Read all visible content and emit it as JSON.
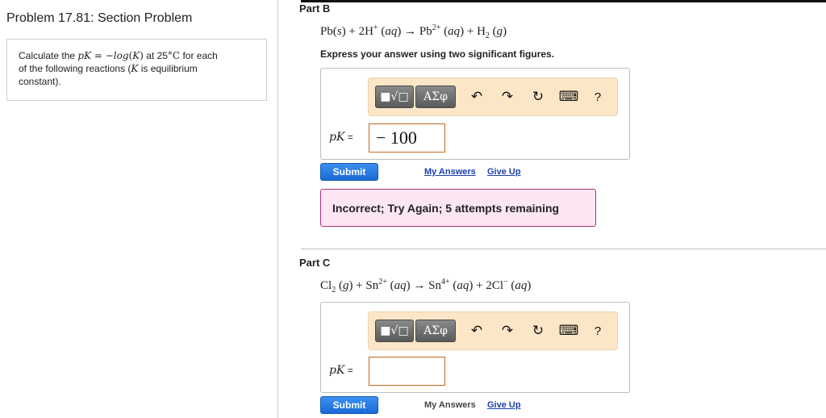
{
  "problem": {
    "title": "Problem 17.81: Section Problem",
    "intro": {
      "calculate": "Calculate the ",
      "pk": "pK",
      "eq_minus_log": " = −",
      "log": "log",
      "open_paren": "(",
      "k": "K",
      "close_paren": ")",
      "at": " at 25",
      "deg_c": "°C",
      "for_each": " for each",
      "line2_a": "of the following reactions (",
      "line2_k": "K",
      "line2_b": " is equilibrium",
      "line3": "constant)."
    }
  },
  "toolbar": {
    "template_symbol": "■√□",
    "greek_label": "ΑΣφ",
    "undo_icon": "↶",
    "redo_icon": "↷",
    "reset_icon": "↻",
    "keyboard_icon": "⌨",
    "help_label": "?"
  },
  "part_b": {
    "label": "Part B",
    "equation": {
      "t1": "Pb(",
      "t1i": "s",
      "t2": ") + 2H",
      "t2s": "+",
      "t3": " (",
      "t3i": "aq",
      "t4": ") → Pb",
      "t4s": "2+",
      "t5": " (",
      "t5i": "aq",
      "t6": ") + H",
      "t6sub": "2",
      "t7": " (",
      "t7i": "g",
      "t8": ")"
    },
    "instruction": "Express your answer using two significant figures.",
    "pk_label": "pK",
    "eq_sign": " =",
    "answer_value": "− 100",
    "submit_label": "Submit",
    "my_answers": "My Answers",
    "give_up": "Give Up",
    "feedback": "Incorrect; Try Again; 5 attempts remaining"
  },
  "part_c": {
    "label": "Part C",
    "equation": {
      "t1": "Cl",
      "t1sub": "2",
      "t2": " (",
      "t2i": "g",
      "t3": ") + Sn",
      "t3s": "2+",
      "t4": " (",
      "t4i": "aq",
      "t5": ") → Sn",
      "t5s": "4+",
      "t6": " (",
      "t6i": "aq",
      "t7": ") + 2Cl",
      "t7s": "−",
      "t8": " (",
      "t8i": "aq",
      "t9": ")"
    },
    "pk_label": "pK",
    "eq_sign": " =",
    "answer_value": "",
    "submit_label": "Submit",
    "my_answers": "My Answers",
    "give_up": "Give Up"
  },
  "colors": {
    "accent_blue": "#1a6ad6",
    "toolbar_bg": "#fbe6c8",
    "feedback_border": "#b0307f",
    "feedback_bg": "#fce6f4",
    "input_border": "#c56a1f"
  }
}
